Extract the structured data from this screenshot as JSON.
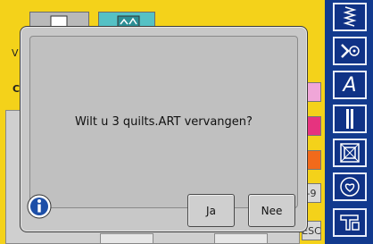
{
  "background": {
    "left_letter_v": "V",
    "left_letter_c": "C",
    "side_label_9": "-9",
    "side_label_esc": "ESC"
  },
  "dialog": {
    "message": "Wilt u 3 quilts.ART vervangen?",
    "yes_label": "Ja",
    "no_label": "Nee"
  },
  "sidebar": {
    "items": [
      {
        "icon": "zigzag-stitch-icon"
      },
      {
        "icon": "decorative-stitch-icon"
      },
      {
        "icon": "alphabet-icon",
        "label": "A"
      },
      {
        "icon": "buttonhole-icon"
      },
      {
        "icon": "quilt-icon"
      },
      {
        "icon": "heart-icon"
      },
      {
        "icon": "embroidery-machine-icon"
      }
    ]
  },
  "colors": {
    "background_yellow": "#f4d21a",
    "sidebar_blue": "#123a8e",
    "dialog_gray": "#c8c8c8"
  }
}
